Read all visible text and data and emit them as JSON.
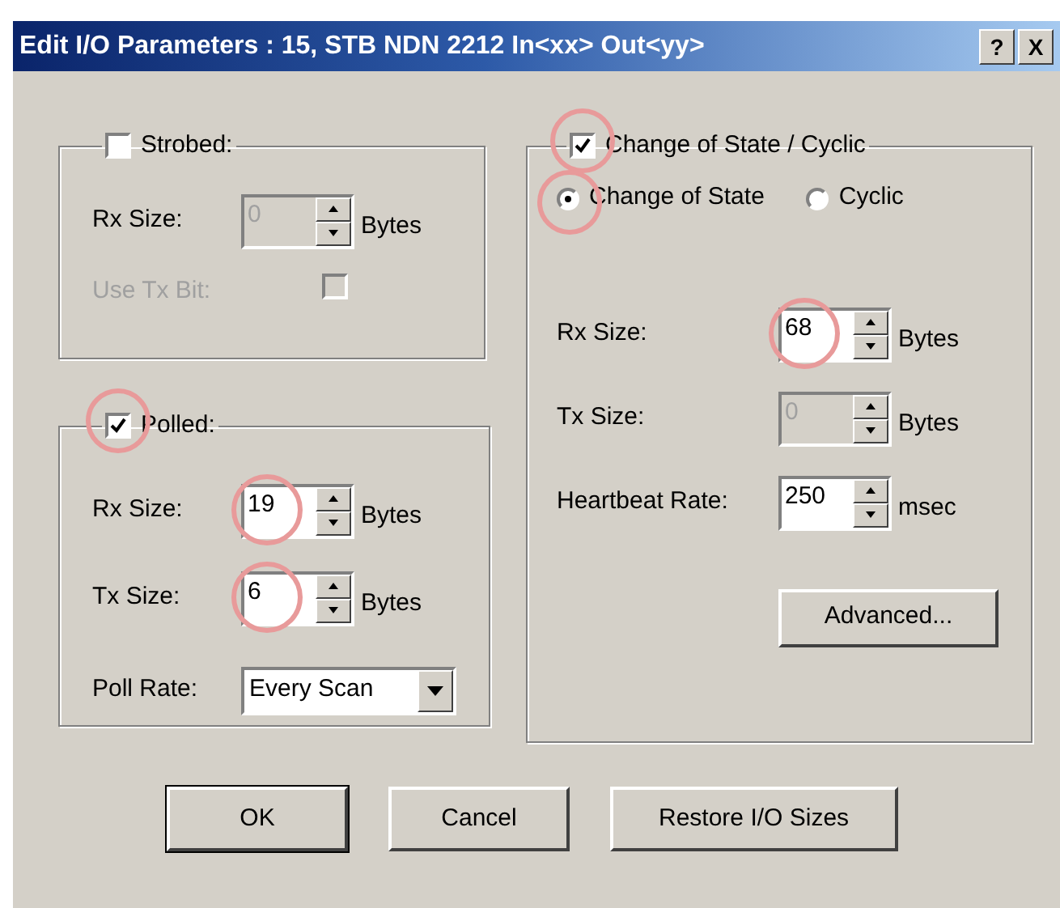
{
  "window": {
    "title": "Edit I/O Parameters : 15, STB NDN 2212 In<xx> Out<yy>",
    "help_button": "?",
    "close_button": "X"
  },
  "strobed": {
    "label": "Strobed:",
    "checked": false,
    "highlighted": false,
    "rows": [
      {
        "kind": "spin",
        "label": "Rx Size:",
        "value": "0",
        "unit": "Bytes",
        "disabled": true,
        "highlighted": false
      },
      {
        "kind": "check",
        "label": "Use Tx Bit:",
        "checked": false,
        "disabled": true
      }
    ]
  },
  "polled": {
    "label": "Polled:",
    "checked": true,
    "highlighted": true,
    "rows": [
      {
        "kind": "spin",
        "label": "Rx Size:",
        "value": "19",
        "unit": "Bytes",
        "disabled": false,
        "highlighted": true
      },
      {
        "kind": "spin",
        "label": "Tx Size:",
        "value": "6",
        "unit": "Bytes",
        "disabled": false,
        "highlighted": true
      },
      {
        "kind": "select",
        "label": "Poll Rate:",
        "value": "Every Scan"
      }
    ]
  },
  "cos": {
    "label": "Change of State / Cyclic",
    "checked": true,
    "highlighted": true,
    "modes": [
      {
        "label": "Change of State",
        "selected": true,
        "highlighted": true
      },
      {
        "label": "Cyclic",
        "selected": false,
        "highlighted": false
      }
    ],
    "rows": [
      {
        "kind": "spin",
        "label": "Rx Size:",
        "value": "68",
        "unit": "Bytes",
        "disabled": false,
        "highlighted": true
      },
      {
        "kind": "spin",
        "label": "Tx Size:",
        "value": "0",
        "unit": "Bytes",
        "disabled": true,
        "highlighted": false
      },
      {
        "kind": "spin",
        "label": "Heartbeat Rate:",
        "value": "250",
        "unit": "msec",
        "disabled": false,
        "highlighted": false
      }
    ],
    "advanced_button": "Advanced..."
  },
  "buttons": [
    {
      "label": "OK",
      "default": true
    },
    {
      "label": "Cancel",
      "default": false
    },
    {
      "label": "Restore I/O Sizes",
      "default": false
    }
  ]
}
